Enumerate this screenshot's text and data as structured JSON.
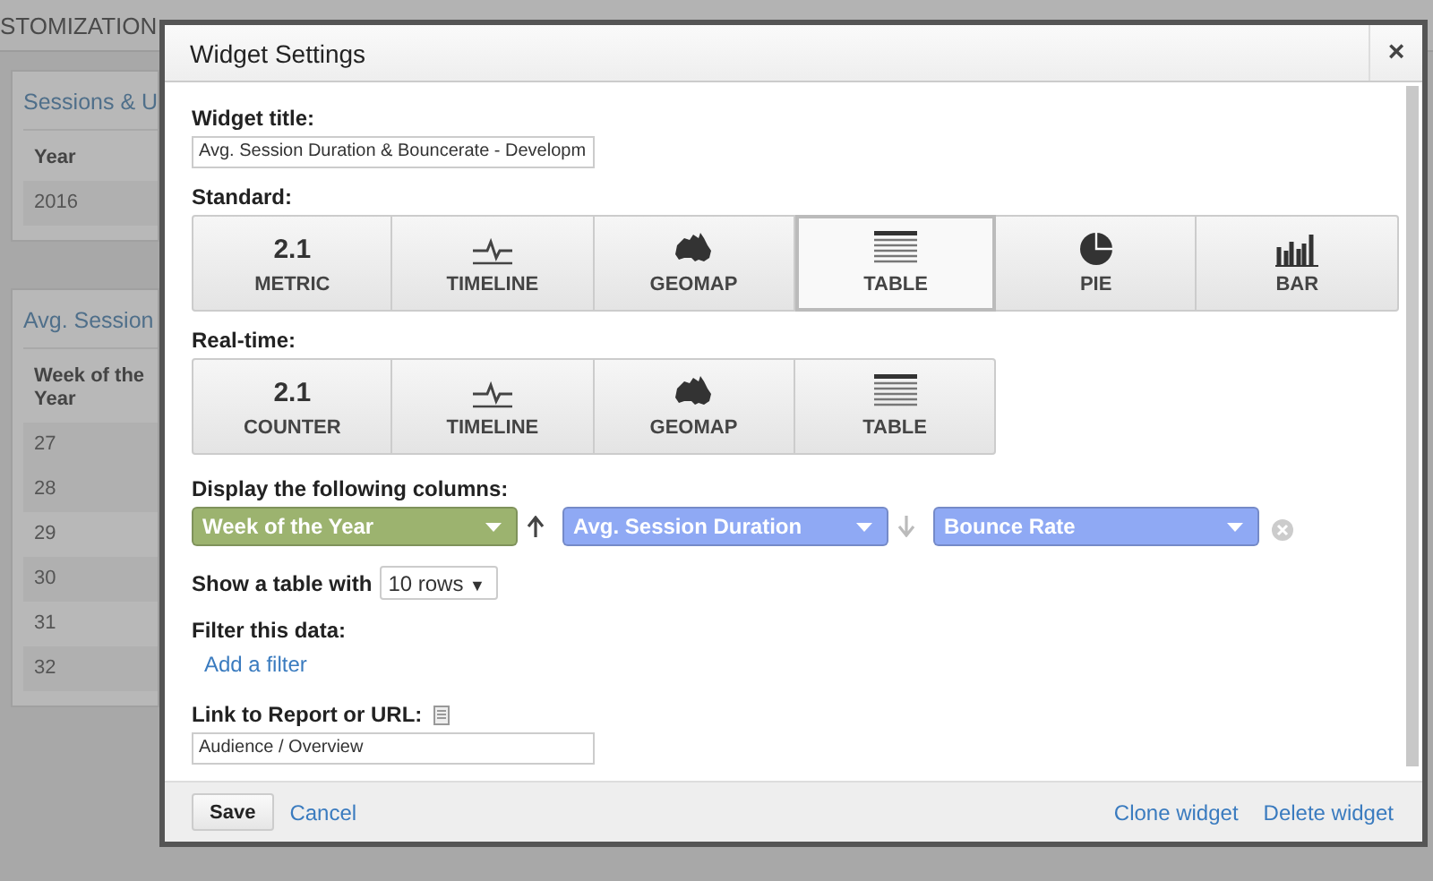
{
  "nav": [
    "STOMIZATION"
  ],
  "cards": [
    {
      "title": "Sessions & U",
      "header": "Year",
      "rows": [
        "2016"
      ]
    },
    {
      "title": "Avg. Session",
      "header": "Week of the Year",
      "rows": [
        "27",
        "28",
        "29",
        "30",
        "31",
        "32"
      ]
    }
  ],
  "dialog": {
    "title": "Widget Settings",
    "close": "×",
    "widget_title": {
      "label": "Widget title:",
      "value": "Avg. Session Duration & Bouncerate - Developm"
    },
    "standard": {
      "label": "Standard:",
      "options": [
        {
          "kind": "number",
          "value": "2.1",
          "label": "METRIC",
          "selected": false
        },
        {
          "kind": "timeline",
          "label": "TIMELINE",
          "selected": false
        },
        {
          "kind": "geomap",
          "label": "GEOMAP",
          "selected": false
        },
        {
          "kind": "table",
          "label": "TABLE",
          "selected": true
        },
        {
          "kind": "pie",
          "label": "PIE",
          "selected": false
        },
        {
          "kind": "bar",
          "label": "BAR",
          "selected": false
        }
      ]
    },
    "realtime": {
      "label": "Real-time:",
      "options": [
        {
          "kind": "number",
          "value": "2.1",
          "label": "COUNTER",
          "selected": false
        },
        {
          "kind": "timeline",
          "label": "TIMELINE",
          "selected": false
        },
        {
          "kind": "geomap",
          "label": "GEOMAP",
          "selected": false
        },
        {
          "kind": "table",
          "label": "TABLE",
          "selected": false
        }
      ]
    },
    "columns": {
      "label": "Display the following columns:",
      "items": [
        {
          "name": "Week of the Year",
          "color": "#9cb36f",
          "move_up": true,
          "move_down": false,
          "arrow_disabled": false,
          "removable": false
        },
        {
          "name": "Avg. Session Duration",
          "color": "#8fa9f4",
          "move_up": false,
          "move_down": true,
          "arrow_disabled": true,
          "removable": false
        },
        {
          "name": "Bounce Rate",
          "color": "#8fa9f4",
          "move_up": false,
          "move_down": false,
          "removable": true
        }
      ]
    },
    "rows": {
      "label": "Show a table with",
      "value": "10 rows",
      "caret": "▼"
    },
    "filter": {
      "label": "Filter this data:",
      "link": "Add a filter"
    },
    "link": {
      "label": "Link to Report or URL:",
      "value": "Audience / Overview"
    },
    "footer": {
      "save": "Save",
      "cancel": "Cancel",
      "actions": [
        "Clone widget",
        "Delete widget"
      ]
    }
  }
}
